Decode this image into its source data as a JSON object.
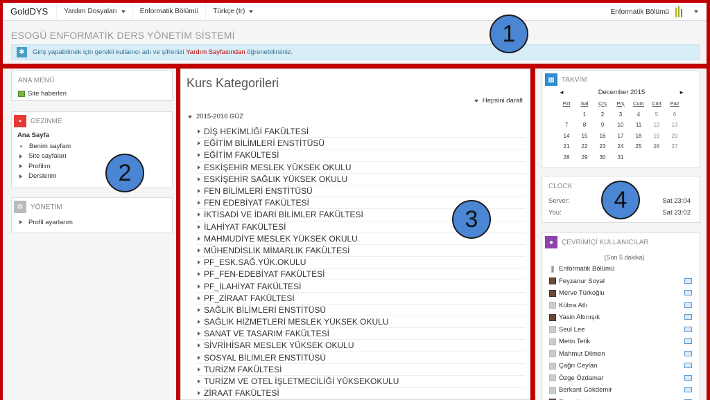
{
  "navbar": {
    "brand": "GoldDYS",
    "items": [
      {
        "label": "Yardım Dosyaları",
        "dropdown": true
      },
      {
        "label": "Enformatik Bölümü",
        "dropdown": false
      },
      {
        "label": "Türkçe (tr)",
        "dropdown": true
      }
    ],
    "user_name": "Enformatik Bölümü"
  },
  "header": {
    "site_title": "ESOGÜ ENFORMATİK DERS YÖNETİM SİSTEMİ",
    "alert_icon": "asterisk-icon",
    "alert_text_before": "Giriş yapabilmek için gerekli kullanıcı adı ve şifrenizi ",
    "alert_link": "Yardım Sayfasından",
    "alert_text_after": " öğrenebilirsiniz."
  },
  "left": {
    "main_menu": {
      "title": "ANA MENÜ",
      "items": [
        "Site haberleri"
      ]
    },
    "navigation": {
      "title": "GEZİNME",
      "home": "Ana Sayfa",
      "items": [
        {
          "label": "Benim sayfam",
          "type": "bullet"
        },
        {
          "label": "Site sayfaları",
          "type": "expand"
        },
        {
          "label": "Profilim",
          "type": "expand"
        },
        {
          "label": "Derslerim",
          "type": "expand"
        }
      ]
    },
    "admin": {
      "title": "YÖNETİM",
      "items": [
        "Profil ayarlarım"
      ]
    }
  },
  "center": {
    "title": "Kurs Kategorileri",
    "collapse_all": "Hepsini daralt",
    "root_category": "2015-2016 GÜZ",
    "categories": [
      "DİŞ HEKİMLİĞİ FAKÜLTESİ",
      "EĞİTİM BİLİMLERİ ENSTİTÜSÜ",
      "EĞİTİM FAKÜLTESİ",
      "ESKİŞEHİR MESLEK YÜKSEK OKULU",
      "ESKİŞEHİR SAĞLIK YÜKSEK OKULU",
      "FEN BİLİMLERİ ENSTİTÜSÜ",
      "FEN EDEBİYAT FAKÜLTESİ",
      "İKTİSADİ VE İDARİ BİLİMLER FAKÜLTESİ",
      "İLAHİYAT FAKÜLTESİ",
      "MAHMUDİYE MESLEK YÜKSEK OKULU",
      "MÜHENDİSLİK MİMARLIK FAKÜLTESİ",
      "PF_ESK.SAĞ.YÜK.OKULU",
      "PF_FEN-EDEBİYAT FAKÜLTESİ",
      "PF_İLAHİYAT FAKÜLTESİ",
      "PF_ZİRAAT FAKÜLTESİ",
      "SAĞLIK BİLİMLERİ ENSTİTÜSÜ",
      "SAĞLIK HİZMETLERİ MESLEK YÜKSEK OKULU",
      "SANAT VE TASARIM FAKÜLTESİ",
      "SİVRİHİSAR MESLEK YÜKSEK OKULU",
      "SOSYAL BİLİMLER ENSTİTÜSÜ",
      "TURİZM FAKÜLTESİ",
      "TURİZM VE OTEL İŞLETMECİLİĞİ YÜKSEKOKULU",
      "ZİRAAT FAKÜLTESİ"
    ]
  },
  "right": {
    "calendar": {
      "title": "TAKVİM",
      "month": "December 2015",
      "prev": "◄",
      "next": "►",
      "weekdays": [
        "Pzt",
        "Sal",
        "Çrş",
        "Prş",
        "Cum",
        "Cmt",
        "Paz"
      ],
      "weeks": [
        [
          "",
          "1",
          "2",
          "3",
          "4",
          "5",
          "6"
        ],
        [
          "7",
          "8",
          "9",
          "10",
          "11",
          "12",
          "13"
        ],
        [
          "14",
          "15",
          "16",
          "17",
          "18",
          "19",
          "20"
        ],
        [
          "21",
          "22",
          "23",
          "24",
          "25",
          "26",
          "27"
        ],
        [
          "28",
          "29",
          "30",
          "31",
          "",
          "",
          ""
        ]
      ],
      "today": "26"
    },
    "clock": {
      "title": "CLOCK",
      "server_label": "Server:",
      "server_time": "Sat 23:04",
      "you_label": "You:",
      "you_time": "Sat 23:02"
    },
    "online": {
      "title": "ÇEVRİMİÇİ KULLANICILAR",
      "subtitle": "(Son 5 dakika)",
      "users": [
        {
          "name": "Enformatik Bölümü",
          "avatar": "thin",
          "message": false
        },
        {
          "name": "Feyzanur Soyal",
          "avatar": "photo",
          "message": true
        },
        {
          "name": "Merve Türkoğlu",
          "avatar": "photo",
          "message": true
        },
        {
          "name": "Kübra Atlı",
          "avatar": "default",
          "message": true
        },
        {
          "name": "Yasin Altınışık",
          "avatar": "photo",
          "message": true
        },
        {
          "name": "Seul Lee",
          "avatar": "default",
          "message": true
        },
        {
          "name": "Metin Tetik",
          "avatar": "default",
          "message": true
        },
        {
          "name": "Mahmut Dilmen",
          "avatar": "default",
          "message": true
        },
        {
          "name": "Çağrı Ceylan",
          "avatar": "default",
          "message": true
        },
        {
          "name": "Özge Özdamar",
          "avatar": "default",
          "message": true
        },
        {
          "name": "Berkant Gökdemir",
          "avatar": "default",
          "message": true
        },
        {
          "name": "Emre Uçak",
          "avatar": "photo",
          "message": true
        }
      ]
    }
  },
  "badges": [
    "1",
    "2",
    "3",
    "4"
  ],
  "colors": {
    "frame": "#c00000",
    "badge": "#4a86d4",
    "alert_bg": "#d9edf7",
    "link": "#c00000"
  }
}
